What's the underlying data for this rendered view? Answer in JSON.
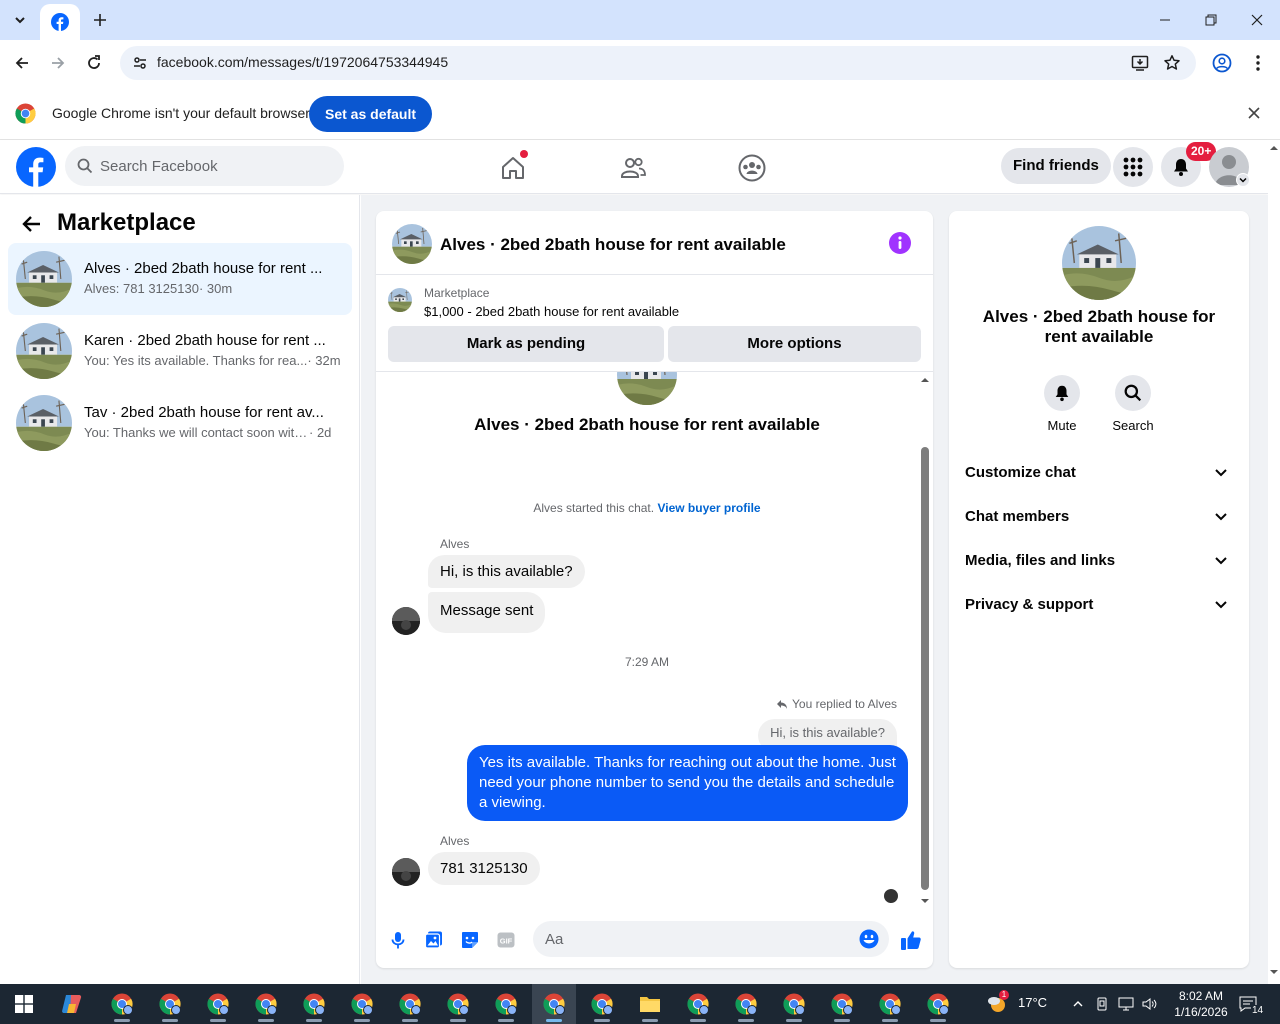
{
  "browser": {
    "url": "facebook.com/messages/t/1972064753344945",
    "infobar_text": "Google Chrome isn't your default browser",
    "infobar_button": "Set as default"
  },
  "fb_header": {
    "search_placeholder": "Search Facebook",
    "find_friends": "Find friends",
    "notifications_badge": "20+"
  },
  "left_panel": {
    "title": "Marketplace",
    "conversations": [
      {
        "name": "Alves · 2bed 2bath house for rent ...",
        "snippet": "Alves: 781 3125130",
        "time": "· 30m",
        "active": true
      },
      {
        "name": "Karen · 2bed 2bath house for rent ...",
        "snippet": "You: Yes its available. Thanks for rea...",
        "time": "· 32m",
        "active": false
      },
      {
        "name": "Tav · 2bed 2bath house for rent av...",
        "snippet": "You: Thanks we will contact soon with...",
        "time": "· 2d",
        "active": false
      }
    ]
  },
  "chat": {
    "header_title": "Alves · 2bed 2bath house for rent available",
    "listing_kicker": "Marketplace",
    "listing_title": "$1,000 - 2bed 2bath house for rent available",
    "btn_pending": "Mark as pending",
    "btn_more": "More options",
    "hero_title": "Alves · 2bed 2bath house for rent available",
    "started_text": "Alves started this chat.",
    "view_profile": "View buyer profile",
    "sender1": "Alves",
    "msg1": "Hi, is this available?",
    "msg2": "Message sent",
    "time_sep": "7:29 AM",
    "replied_to": "You replied to Alves",
    "reply_quote": "Hi, is this available?",
    "msg_out": "Yes its available. Thanks for reaching out about the home. Just need your phone number to send you the details and schedule a viewing.",
    "sender2": "Alves",
    "msg3": "781 3125130",
    "composer_placeholder": "Aa"
  },
  "right_panel": {
    "title": "Alves · 2bed 2bath house for rent available",
    "mute": "Mute",
    "search": "Search",
    "rows": [
      "Customize chat",
      "Chat members",
      "Media, files and links",
      "Privacy & support"
    ]
  },
  "taskbar": {
    "temperature": "17°C",
    "time": "8:02 AM",
    "date": "1/16/2026",
    "notification_count": "14",
    "weather_badge": "1"
  },
  "colors": {
    "fb_blue": "#0866ff",
    "chrome_blue": "#0b57d0",
    "outgoing_bubble": "#0a5af6",
    "badge_red": "#e41e3f",
    "info_purple": "#a033ff"
  }
}
